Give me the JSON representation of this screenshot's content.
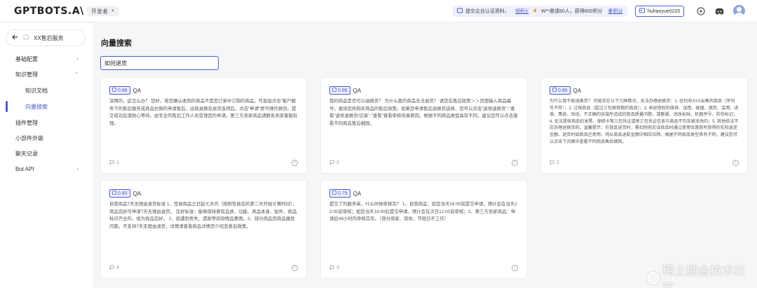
{
  "header": {
    "logo": "GPTBOTS.A\\",
    "env_label": "开发者",
    "notice1_text": "提交企业认证资料，",
    "notice1_link": "领积分",
    "notice2_text": "W**邀请80人，获得800积分",
    "notice2_link": "拿积分",
    "username": "huhaoyue0220"
  },
  "sidebar": {
    "bot_name": "XX售后服务",
    "items": [
      {
        "label": "基础配置",
        "arrow": "›"
      },
      {
        "label": "知识管理",
        "arrow": "⌃"
      },
      {
        "label": "知识文档"
      },
      {
        "label": "向量搜索"
      },
      {
        "label": "插件管理"
      },
      {
        "label": "小部件外嵌"
      },
      {
        "label": "聊天记录"
      },
      {
        "label": "Bot API",
        "arrow": "›"
      }
    ]
  },
  "main": {
    "title": "向量搜索",
    "search_value": "如何退货",
    "cards": [
      {
        "score": "0.88",
        "type": "QA",
        "text": "深情的，这怎么办？ 您好，若您确认收到的商品不是您订单中订购的商品，可直接点击\"客户服务下的售后服务或商品右侧的申请售后，出现退换及退货选项后，点击\"申请\"即可操作换货。提交成功后请耐心等待，由专业的售后工作人员受理您的申请。第三方卖家商品请联系卖家客服处理。",
        "count": "1"
      },
      {
        "score": "0.86",
        "type": "QA",
        "text": "我的商品是否可以退换货？ 为什么我的商品无法退货？ 请您在售后政策＞＞页面输入商品编号，查询您所购买商品的售后政策。如果您申请售后退换货选择，您可以点击\"返修退换货\"-\"查看\"返修退换货/记录\"-\"查看\"查看审核结果原因。根据不同商品类型具有不同，建议您可以点击查看不同商品售后细则。",
        "count": "2"
      },
      {
        "score": "0.86",
        "type": "QA",
        "text": "为什么我不能退换货？ 可能存在以下几种情况，无法办理退换货：1. 任何非XXX出售的商品（序列号不符）；2. 过保商品（超过三包保修期的商品）；3. 未经授权的维修、误用、碰撞、疏忽、滥用、进液、事故、改动、不正确的安装所造成的商品质量问题，或撕毁、涂改标贴、机器序号、防伪标记；4. 无法提供商品的发票、保修卡等三包凭证或者三包凭证信息与商品不符及被涂改的；5. 其他依法不应办理退换货的。温馨提示：在商品退货时，需扣除购买该商品时通过使用优惠券所获得的实际返还金额。退货时如商品已使用，则从商品退款金额中相应扣除。根据不同商品类型具有不同，建议您可以点击下页面中查看不同商品售后细则。",
        "count": "2"
      },
      {
        "score": "0.85",
        "type": "QA",
        "text": "自营商品7天无理由退货标准 1、签收商品之日起七天内（按照签收后的第二天开始计算时间），商品完好可申请7天无理由退货。 完好标准：能够保持原有品质、功能、商品本身、配件、商品标识齐全的，视为商品完好。 2、如遇到丢失、遗款等扣除物品费用。3、部分商品因商品属性问题，不支持7天无理由退货，详情请查看商品详情页介绍及售后政策。",
        "count": "4"
      },
      {
        "score": "0.79",
        "type": "QA",
        "text": "提交了的服务单，什么时候审核完？ 1、自营商品：如您当天18:00前提交申请，预计会在当天22:00前审核；如您当天18:00后提交申请，预计会在次日12:00前审核；2、第三方卖家商品：申请后48小时内审核完毕。（部分商家、双休、节假日不工作）",
        "count": "3"
      }
    ]
  },
  "watermark": "稀土掘金技术社区"
}
